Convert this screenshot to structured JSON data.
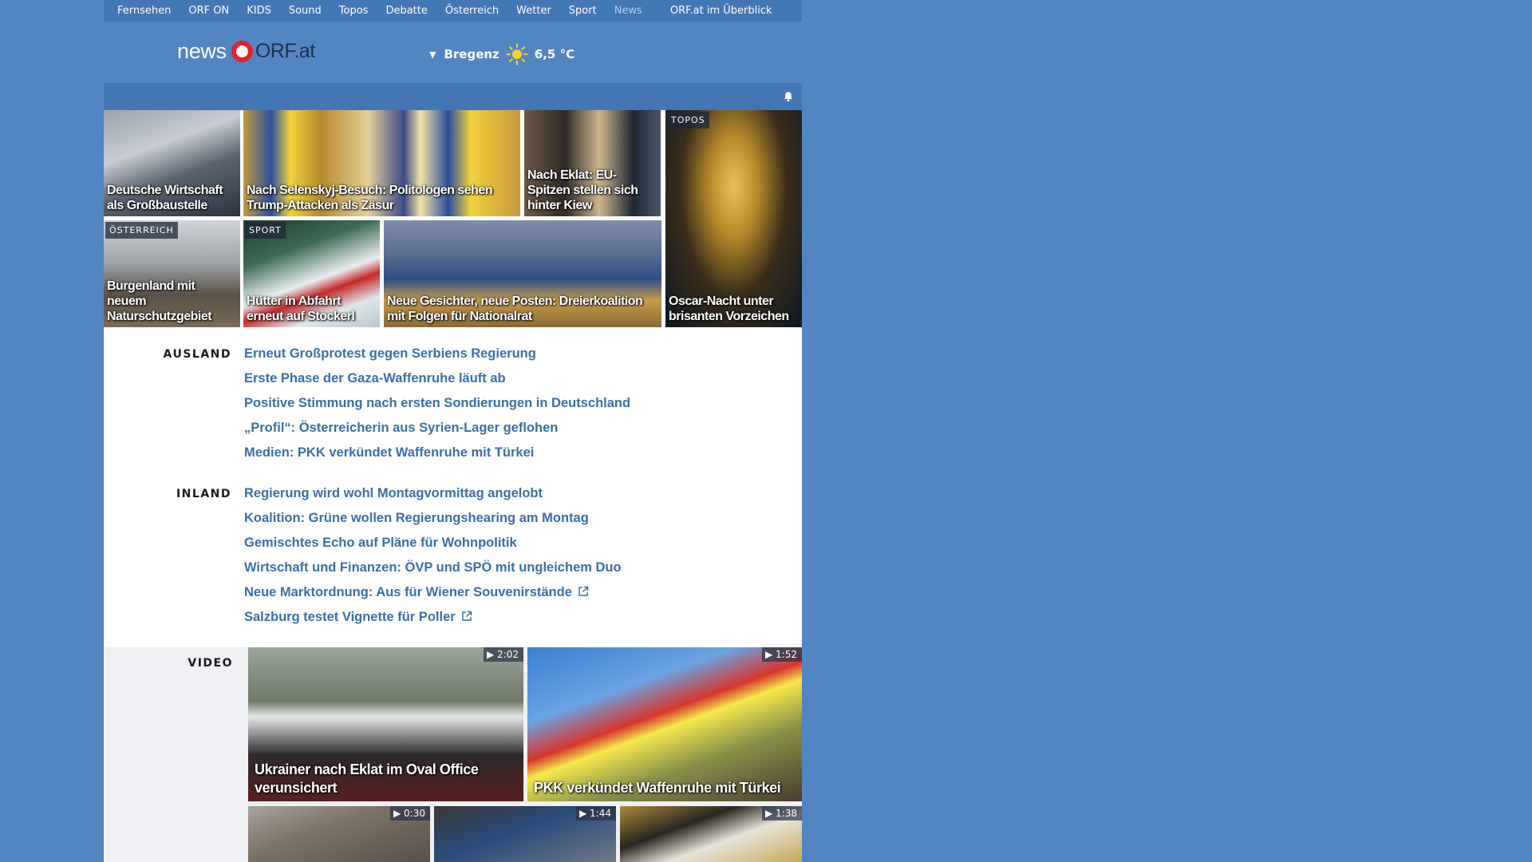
{
  "nav": {
    "items": [
      "Fernsehen",
      "ORF ON",
      "KIDS",
      "Sound",
      "Topos",
      "Debatte",
      "Österreich",
      "Wetter",
      "Sport"
    ],
    "active": "News",
    "overview": "ORF.at im Überblick"
  },
  "header": {
    "logo_news": "news",
    "logo_orf": "ORF.at",
    "weather_city": "Bregenz",
    "weather_temp": "6,5 °C",
    "weather_icon": "sun-icon"
  },
  "teasers": [
    {
      "title": "Deutsche Wirtschaft als Großbaustelle",
      "tag": ""
    },
    {
      "title": "Nach Selenskyj-Besuch: Politologen sehen Trump-Attacken als Zäsur",
      "tag": ""
    },
    {
      "title": "Nach Eklat: EU-Spitzen stellen sich hinter Kiew",
      "tag": ""
    },
    {
      "title": "Oscar-Nacht unter brisanten Vorzeichen",
      "tag": "TOPOS"
    },
    {
      "title": "Burgenland mit neuem Naturschutzgebiet",
      "tag": "ÖSTERREICH"
    },
    {
      "title": "Hütter in Abfahrt erneut auf Stockerl",
      "tag": "SPORT"
    },
    {
      "title": "Neue Gesichter, neue Posten: Dreierkoalition mit Folgen für Nationalrat",
      "tag": ""
    }
  ],
  "ausland": {
    "label": "AUSLAND",
    "links": [
      "Erneut Großprotest gegen Serbiens Regierung",
      "Erste Phase der Gaza-Waffenruhe läuft ab",
      "Positive Stimmung nach ersten Sondierungen in Deutschland",
      "„Profil“: Österreicherin aus Syrien-Lager geflohen",
      "Medien: PKK verkündet Waffenruhe mit Türkei"
    ]
  },
  "inland": {
    "label": "INLAND",
    "links": [
      "Regierung wird wohl Montagvormittag angelobt",
      "Koalition: Grüne wollen Regierungshearing am Montag",
      "Gemischtes Echo auf Pläne für Wohnpolitik",
      "Wirtschaft und Finanzen: ÖVP und SPÖ mit ungleichem Duo",
      "Neue Marktordnung: Aus für Wiener Souvenirstände",
      "Salzburg testet Vignette für Poller"
    ]
  },
  "video": {
    "label": "VIDEO",
    "items": [
      {
        "title": "Ukrainer nach Eklat im Oval Office verunsichert",
        "duration": "2:02"
      },
      {
        "title": "PKK verkündet Waffenruhe mit Türkei",
        "duration": "1:52"
      },
      {
        "title": "",
        "duration": "0:30"
      },
      {
        "title": "",
        "duration": "1:44"
      },
      {
        "title": "",
        "duration": "1:38"
      }
    ]
  },
  "colors": {
    "background": "#5286c2",
    "nav": "#4377b3",
    "link": "#3a6ea8",
    "orf_red": "#e3212d"
  }
}
